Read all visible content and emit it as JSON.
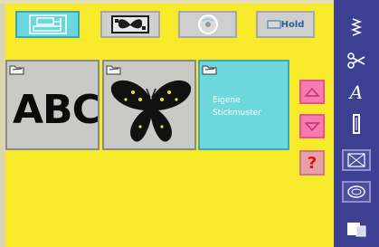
{
  "top_tabs": [
    {
      "name": "tab-sewing-machine",
      "icon": "sewing-machine-icon",
      "active": true
    },
    {
      "name": "tab-embroidery-designs",
      "icon": "butterfly-hoop-icon",
      "active": false
    },
    {
      "name": "tab-disk",
      "icon": "disk-icon",
      "active": false
    },
    {
      "name": "tab-usb-stick",
      "icon": "usb-stick-icon",
      "active": false
    }
  ],
  "usb_tab": {
    "label": "Hold"
  },
  "tiles": [
    {
      "name": "alphabet-designs-tile",
      "label": "ABC"
    },
    {
      "name": "butterfly-designs-tile",
      "icon": "butterfly-icon"
    },
    {
      "name": "my-designs-tile",
      "label_line1": "Eigene",
      "label_line2": "Stickmuster"
    }
  ],
  "help_button": {
    "label": "?"
  },
  "sidebar": {
    "items": [
      {
        "icon": "straight-stitch-icon"
      },
      {
        "icon": "scissors-icon"
      },
      {
        "icon": "alphabet-icon",
        "glyph": "A"
      },
      {
        "icon": "buttonhole-icon"
      },
      {
        "icon": "quilt-stitch-icon"
      },
      {
        "icon": "embroidery-hoop-icon"
      },
      {
        "icon": "file-folder-icon"
      }
    ]
  },
  "colors": {
    "background": "#f7ea2a",
    "sidebar": "#3d3f93",
    "active_tab": "#6ad6de",
    "scroll_button": "#f77bb0"
  }
}
